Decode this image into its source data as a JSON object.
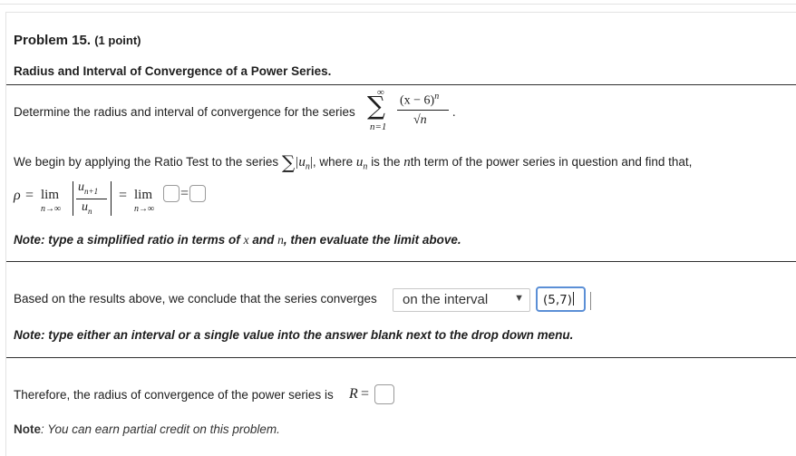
{
  "problem": {
    "title": "Problem 15.",
    "points": "(1 point)",
    "subtitle": "Radius and Interval of Convergence of a Power Series."
  },
  "series": {
    "prompt": "Determine the radius and interval of convergence for the series",
    "upper_limit": "∞",
    "lower_limit": "n=1",
    "numerator": "(x − 6)",
    "exponent": "n",
    "denominator": "√n",
    "end_punct": "."
  },
  "ratio": {
    "text_before": "We begin by applying the Ratio Test to the series",
    "abs_term": "|u",
    "abs_sub": "n",
    "abs_close": "|",
    "text_middle": ", where",
    "u_var": "u",
    "u_sub": "n",
    "text_after": "is the",
    "nth_var": "n",
    "text_end": "th term of the power series in question and find that,"
  },
  "limit": {
    "rho": "ρ",
    "eq": "=",
    "lim": "lim",
    "lim_sub": "n→∞",
    "num": "u",
    "num_sub": "n+1",
    "den": "u",
    "den_sub": "n",
    "eq2": "=",
    "lim2": "lim",
    "lim2_sub": "n→∞",
    "eq3": "="
  },
  "note1": {
    "before": "Note: type a simplified ratio in terms of",
    "x": "x",
    "and": "and",
    "n": "n",
    "after": ", then evaluate the limit above."
  },
  "conclusion": {
    "text": "Based on the results above, we conclude that the series converges",
    "dropdown_selected": "on the interval",
    "answer_value": "(5,7)"
  },
  "note2": "Note: type either an interval or a single value into the answer blank next to the drop down menu.",
  "radius": {
    "text": "Therefore, the radius of convergence of the power series is",
    "var": "R",
    "eq": "="
  },
  "note3": {
    "label": "Note",
    "text": ": You can earn partial credit on this problem."
  }
}
